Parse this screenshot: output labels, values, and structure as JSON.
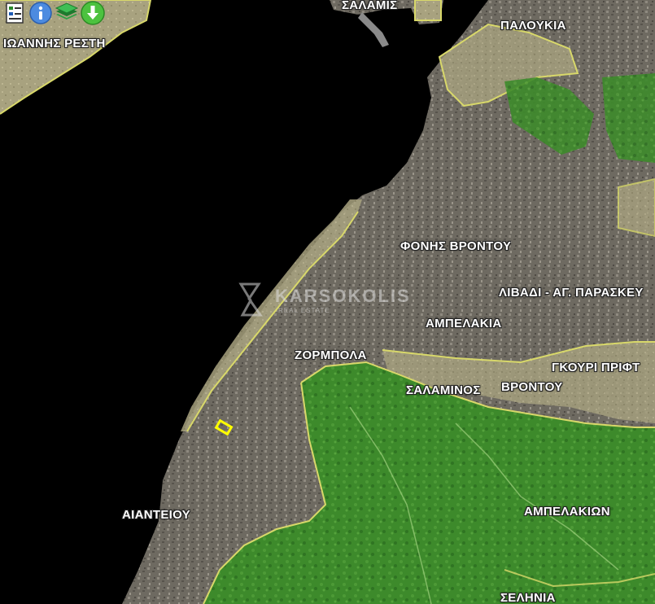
{
  "toolbar": {
    "buttons": [
      {
        "icon": "legend-icon"
      },
      {
        "icon": "info-icon"
      },
      {
        "icon": "layers-icon"
      },
      {
        "icon": "download-icon"
      }
    ]
  },
  "labels": {
    "salamis": "ΣΑΛΑΜΙΣ",
    "ioannis_resti": "ΙΩΑΝΝΗΣ ΡΕΣΤΗ",
    "paloukia": "ΠΑΛΟΥΚΙΑ",
    "fonis_vrontou": "ΦΟΝΗΣ ΒΡΟΝΤΟΥ",
    "livadi": "ΛΙΒΑΔΙ - ΑΓ. ΠΑΡΑΣΚΕΥ",
    "ampelakia": "ΑΜΠΕΛΑΚΙΑ",
    "zormpola": "ΖΟΡΜΠΟΛΑ",
    "gkouri": "ΓΚΟΥΡΙ ΠΡΙΦΤ",
    "salaminos": "ΣΑΛΑΜΙΝΟΣ",
    "vrontou": "ΒΡΟΝΤΟΥ",
    "aianteiou": "ΑΙΑΝΤΕΙΟΥ",
    "ampelakion": "ΑΜΠΕΛΑΚΙΩΝ",
    "selinia": "ΣΕΛΗΝΙΑ"
  },
  "watermark": {
    "brand": "KARSOKOLIS",
    "subtitle": "REAL ESTATE"
  },
  "colors": {
    "sea": "#000000",
    "urban": "#6f6b62",
    "forest": "#3f8a2a",
    "zone_outline": "#d8d86a",
    "parcel": "#ffff00"
  }
}
